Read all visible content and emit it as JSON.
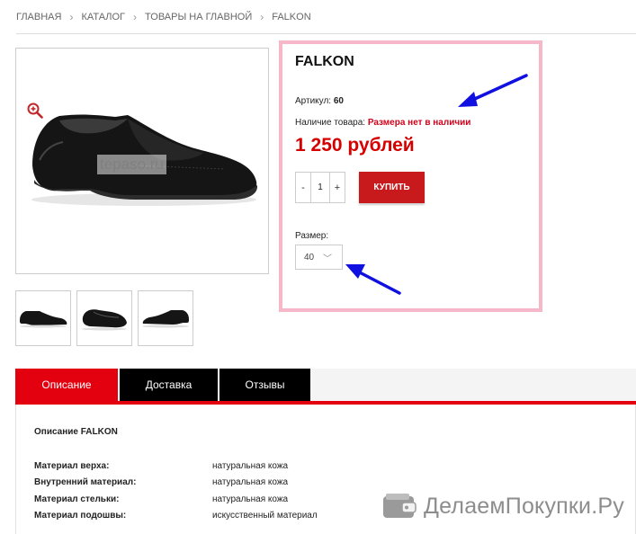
{
  "breadcrumb": {
    "items": [
      "ГЛАВНАЯ",
      "КАТАЛОГ",
      "ТОВАРЫ НА ГЛАВНОЙ",
      "FALKON"
    ],
    "separator": "›"
  },
  "gallery": {
    "watermark": "tepaso.ru"
  },
  "product": {
    "title": "FALKON",
    "article_label": "Артикул:",
    "article_value": "60",
    "stock_label": "Наличие товара:",
    "stock_value": "Размера нет в наличии",
    "price": "1 250 рублей",
    "qty_minus": "-",
    "qty_value": "1",
    "qty_plus": "+",
    "buy_label": "КУПИТЬ",
    "size_label": "Размер:",
    "size_value": "40",
    "size_chevron": "﹀"
  },
  "tabs": [
    {
      "label": "Описание",
      "active": true
    },
    {
      "label": "Доставка",
      "active": false
    },
    {
      "label": "Отзывы",
      "active": false
    }
  ],
  "description": {
    "title": "Описание FALKON",
    "properties": [
      {
        "key": "Материал верха:",
        "value": "натуральная кожа"
      },
      {
        "key": "Внутренний материал:",
        "value": "натуральная кожа"
      },
      {
        "key": "Материал стельки:",
        "value": "натуральная кожа"
      },
      {
        "key": "Материал подошвы:",
        "value": "искусственный материал"
      }
    ]
  },
  "brand": {
    "text": "ДелаемПокупки.Ру"
  },
  "colors": {
    "accent_red": "#e3000f",
    "price_red": "#d60000",
    "highlight_pink": "#f6b8c8",
    "arrow_blue": "#1010e0"
  },
  "icons": [
    "zoom-in-icon",
    "chevron-down-icon",
    "wallet-icon",
    "arrow-annotation-icon"
  ]
}
